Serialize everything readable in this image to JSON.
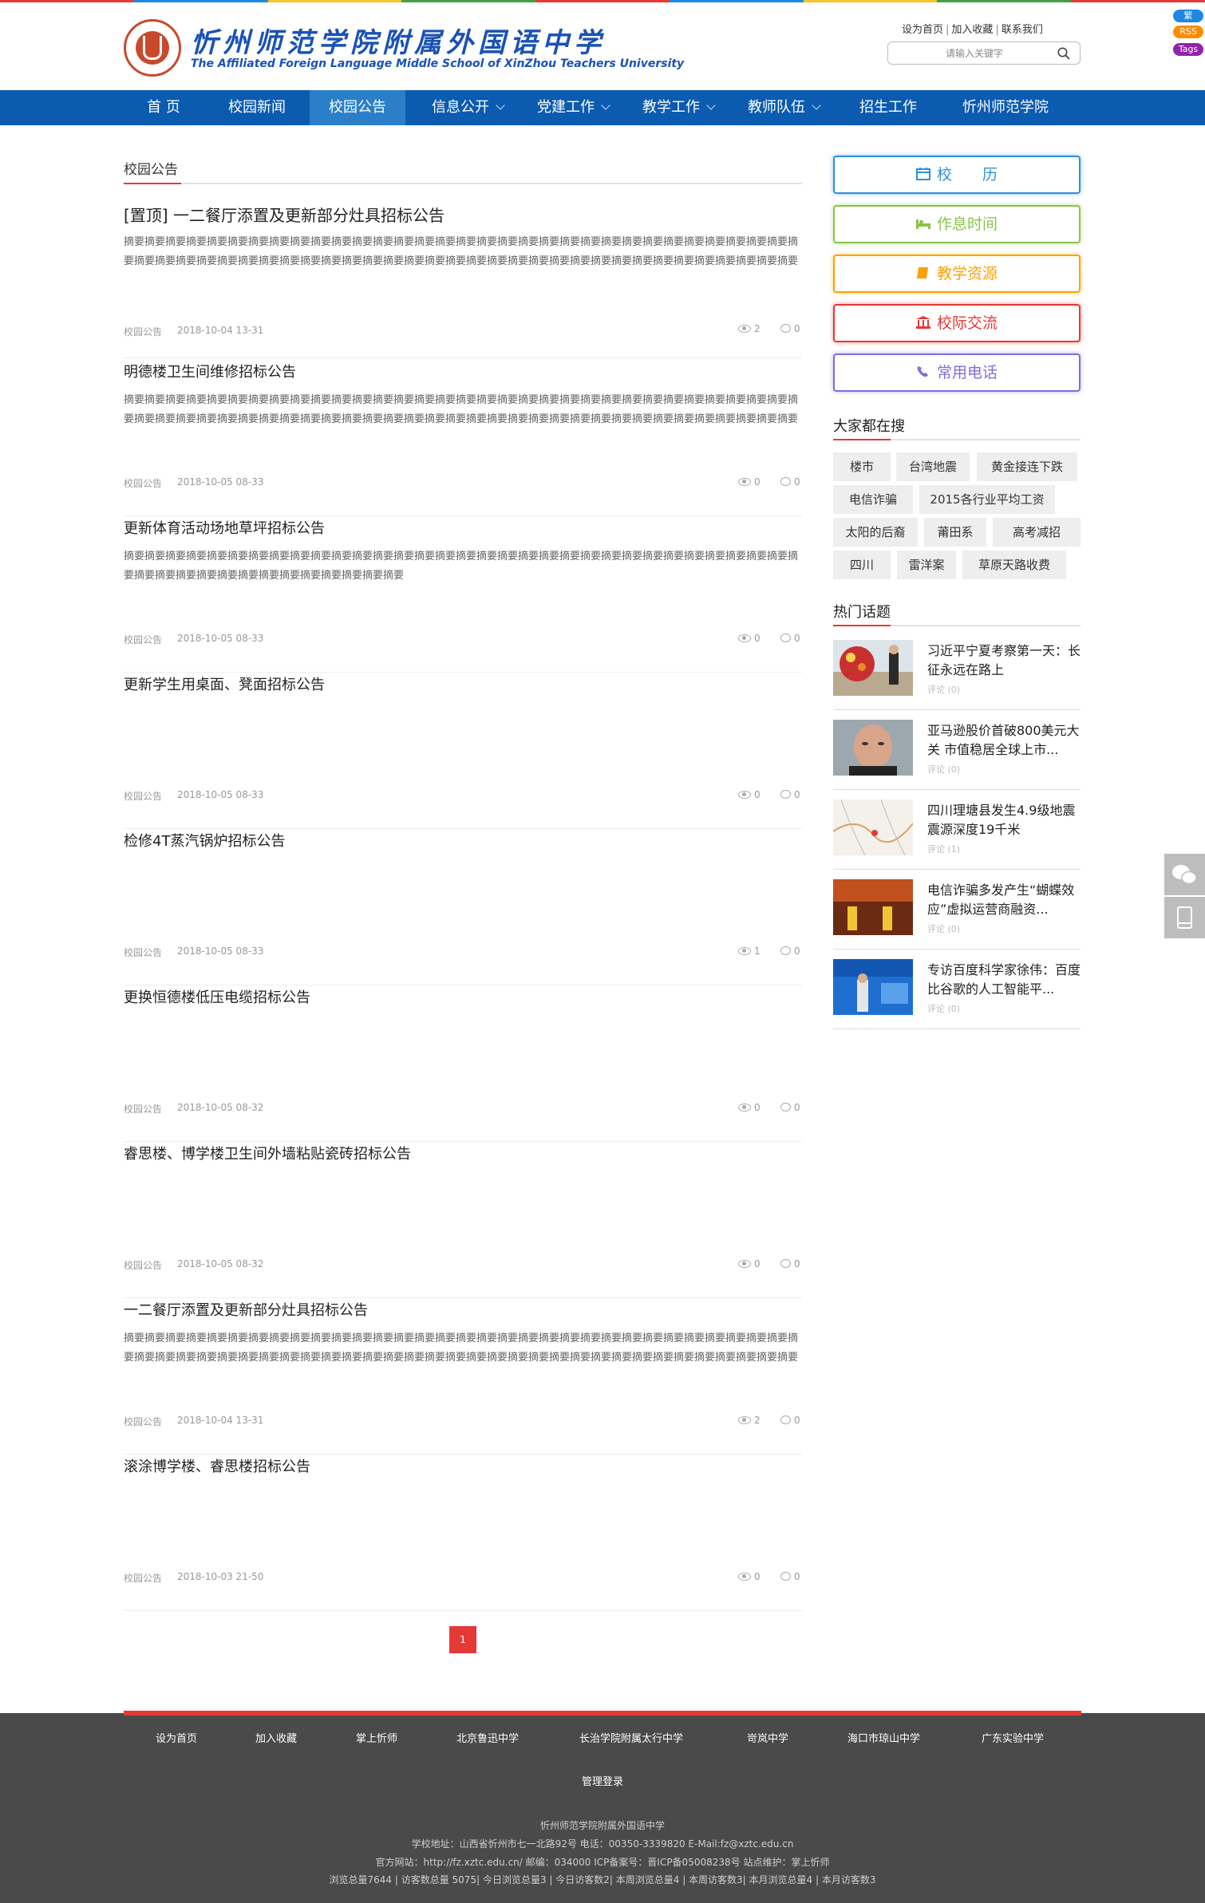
{
  "top_strip_colors": [
    "#e53935",
    "#1e88e5",
    "#fbc02d",
    "#43a047",
    "#e53935",
    "#1e88e5",
    "#fbc02d",
    "#43a047",
    "#e53935"
  ],
  "header": {
    "logo_cn": "忻州师范学院附属外国语中学",
    "logo_en": "The Affiliated Foreign Language Middle School of XinZhou Teachers University",
    "links": [
      "设为首页",
      "加入收藏",
      "联系我们"
    ],
    "search_placeholder": "请输入关键字"
  },
  "badges": [
    {
      "label": "繁",
      "color": "#1e88e5"
    },
    {
      "label": "RSS",
      "color": "#fb8c00"
    },
    {
      "label": "Tags",
      "color": "#8e24aa"
    }
  ],
  "nav": [
    {
      "label": "首 页",
      "caret": false,
      "active": false
    },
    {
      "label": "校园新闻",
      "caret": false,
      "active": false
    },
    {
      "label": "校园公告",
      "caret": false,
      "active": true
    },
    {
      "label": "信息公开",
      "caret": true,
      "active": false
    },
    {
      "label": "党建工作",
      "caret": true,
      "active": false
    },
    {
      "label": "教学工作",
      "caret": true,
      "active": false
    },
    {
      "label": "教师队伍",
      "caret": true,
      "active": false
    },
    {
      "label": "招生工作",
      "caret": false,
      "active": false
    },
    {
      "label": "忻州师范学院",
      "caret": false,
      "active": false
    }
  ],
  "section_title": "校园公告",
  "articles": [
    {
      "title": "[置顶] 一二餐厅添置及更新部分灶具招标公告",
      "desc": "摘要摘要摘要摘要摘要摘要摘要摘要摘要摘要摘要摘要摘要摘要摘要摘要摘要摘要摘要摘要摘要摘要摘要摘要摘要摘要摘要摘要摘要摘要摘要摘要摘要摘要摘要摘要摘要摘要摘要摘要摘要摘要摘要摘要摘要摘要摘要摘要摘要摘要摘要摘要摘要摘要摘要摘要摘要摘要摘要摘要摘要摘要摘要摘要摘要摘要摘要摘要",
      "category": "校园公告",
      "date": "2018-10-04 13-31",
      "views": "2",
      "comments": "0"
    },
    {
      "title": "明德楼卫生间维修招标公告",
      "desc": "摘要摘要摘要摘要摘要摘要摘要摘要摘要摘要摘要摘要摘要摘要摘要摘要摘要摘要摘要摘要摘要摘要摘要摘要摘要摘要摘要摘要摘要摘要摘要摘要摘要摘要摘要摘要摘要摘要摘要摘要摘要摘要摘要摘要摘要摘要摘要摘要摘要摘要摘要摘要摘要摘要摘要摘要摘要摘要摘要摘要摘要摘要摘要摘要摘要摘要摘要摘要摘要摘要",
      "category": "校园公告",
      "date": "2018-10-05 08-33",
      "views": "0",
      "comments": "0"
    },
    {
      "title": "更新体育活动场地草坪招标公告",
      "desc": "摘要摘要摘要摘要摘要摘要摘要摘要摘要摘要摘要摘要摘要摘要摘要摘要摘要摘要摘要摘要摘要摘要摘要摘要摘要摘要摘要摘要摘要摘要摘要摘要摘要摘要摘要摘要摘要摘要摘要摘要摘要摘要摘要摘要摘要摘要",
      "category": "校园公告",
      "date": "2018-10-05 08-33",
      "views": "0",
      "comments": "0"
    },
    {
      "title": "更新学生用桌面、凳面招标公告",
      "desc": "",
      "category": "校园公告",
      "date": "2018-10-05 08-33",
      "views": "0",
      "comments": "0"
    },
    {
      "title": "检修4T蒸汽锅炉招标公告",
      "desc": "",
      "category": "校园公告",
      "date": "2018-10-05 08-33",
      "views": "1",
      "comments": "0"
    },
    {
      "title": "更换恒德楼低压电缆招标公告",
      "desc": "",
      "category": "校园公告",
      "date": "2018-10-05 08-32",
      "views": "0",
      "comments": "0"
    },
    {
      "title": "睿思楼、博学楼卫生间外墙粘贴瓷砖招标公告",
      "desc": "",
      "category": "校园公告",
      "date": "2018-10-05 08-32",
      "views": "0",
      "comments": "0"
    },
    {
      "title": "一二餐厅添置及更新部分灶具招标公告",
      "desc": "摘要摘要摘要摘要摘要摘要摘要摘要摘要摘要摘要摘要摘要摘要摘要摘要摘要摘要摘要摘要摘要摘要摘要摘要摘要摘要摘要摘要摘要摘要摘要摘要摘要摘要摘要摘要摘要摘要摘要摘要摘要摘要摘要摘要摘要摘要摘要摘要摘要摘要摘要摘要摘要摘要摘要摘要摘要摘要摘要摘要摘要摘要摘要摘要摘要摘要摘要摘要",
      "category": "校园公告",
      "date": "2018-10-04 13-31",
      "views": "2",
      "comments": "0"
    },
    {
      "title": "滚涂博学楼、睿思楼招标公告",
      "desc": "",
      "category": "校园公告",
      "date": "2018-10-03 21-50",
      "views": "0",
      "comments": "0"
    }
  ],
  "pager": {
    "current": "1"
  },
  "side_buttons": [
    {
      "label": "校　　历",
      "color": "#2f8fe0",
      "icon": "calendar-icon"
    },
    {
      "label": "作息时间",
      "color": "#8bc34a",
      "icon": "bed-icon"
    },
    {
      "label": "教学资源",
      "color": "#ffa000",
      "icon": "book-icon"
    },
    {
      "label": "校际交流",
      "color": "#e53935",
      "icon": "bank-icon"
    },
    {
      "label": "常用电话",
      "color": "#7e6fd8",
      "icon": "phone-icon"
    }
  ],
  "search_tags_title": "大家都在搜",
  "search_tags": [
    [
      "楼市",
      "台湾地震",
      "黄金接连下跌"
    ],
    [
      "电信诈骗",
      "2015各行业平均工资"
    ],
    [
      "太阳的后裔",
      "莆田系",
      "高考减招"
    ],
    [
      "四川",
      "雷洋案",
      "草原天路收费"
    ]
  ],
  "hot_title": "热门话题",
  "hot": [
    {
      "title": "习近平宁夏考察第一天：长征永远在路上",
      "comment": "评论 (0)",
      "thumb": "flowers"
    },
    {
      "title": "亚马逊股价首破800美元大关 市值稳居全球上市...",
      "comment": "评论 (0)",
      "thumb": "portrait"
    },
    {
      "title": "四川理塘县发生4.9级地震 震源深度19千米",
      "comment": "评论 (1)",
      "thumb": "map"
    },
    {
      "title": "电信诈骗多发产生“蝴蝶效应”虚拟运营商融资...",
      "comment": "评论 (0)",
      "thumb": "stage"
    },
    {
      "title": "专访百度科学家徐伟：百度比谷歌的人工智能平...",
      "comment": "评论 (0)",
      "thumb": "conference"
    }
  ],
  "footer": {
    "links": [
      "设为首页",
      "加入收藏",
      "掌上忻师",
      "北京鲁迅中学",
      "长治学院附属太行中学",
      "岢岚中学",
      "海口市琼山中学",
      "广东实验中学"
    ],
    "admin": "管理登录",
    "school": "忻州师范学院附属外国语中学",
    "address": "学校地址：山西省忻州市七一北路92号 电话：00350-3339820 E-Mail:fz@xztc.edu.cn",
    "site": "官方网站：http://fz.xztc.edu.cn/ 邮编：034000 ICP备案号：晋ICP备05008238号 站点维护：掌上忻师",
    "stats": "浏览总量7644 | 访客数总量 5075| 今日浏览总量3 | 今日访客数2| 本周浏览总量4 | 本周访客数3| 本月浏览总量4 | 本月访客数3"
  }
}
